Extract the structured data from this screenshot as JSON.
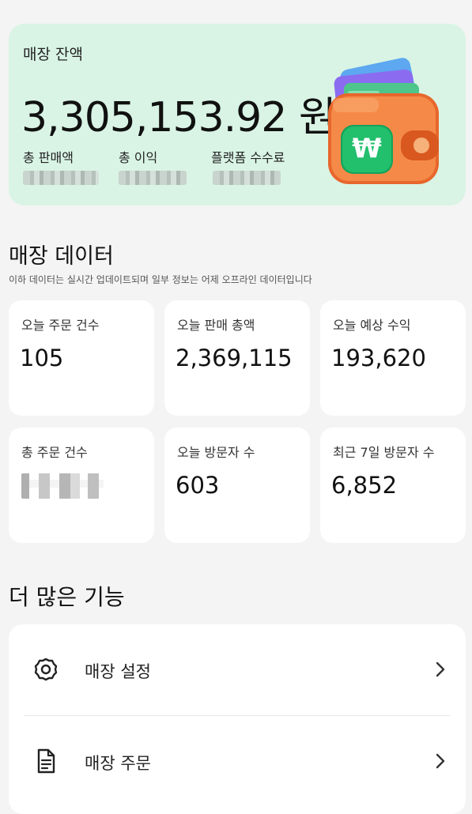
{
  "balance": {
    "title": "매장 잔액",
    "amount": "3,305,153.92 원",
    "stats": [
      {
        "label": "총 판매액"
      },
      {
        "label": "총 이익"
      },
      {
        "label": "플랫폼 수수료"
      }
    ]
  },
  "store_data": {
    "title": "매장 데이터",
    "subtitle": "이하 데이터는 실시간 업데이트되며 일부 정보는 어제 오프라인 데이터입니다",
    "cards": [
      {
        "label": "오늘 주문 건수",
        "value": "105"
      },
      {
        "label": "오늘 판매 총액",
        "value": "2,369,115"
      },
      {
        "label": "오늘 예상 수익",
        "value": "193,620"
      },
      {
        "label": "총 주문 건수",
        "value": ""
      },
      {
        "label": "오늘 방문자 수",
        "value": "603"
      },
      {
        "label": "최근 7일 방문자 수",
        "value": "6,852"
      }
    ]
  },
  "more": {
    "title": "더 많은 기능",
    "items": [
      {
        "label": "매장 설정",
        "icon": "gear-icon"
      },
      {
        "label": "매장 주문",
        "icon": "document-icon"
      }
    ]
  },
  "colors": {
    "balance_bg": "#d9f4e5",
    "wallet_orange": "#f07a3a",
    "won_green": "#1fb96a"
  }
}
